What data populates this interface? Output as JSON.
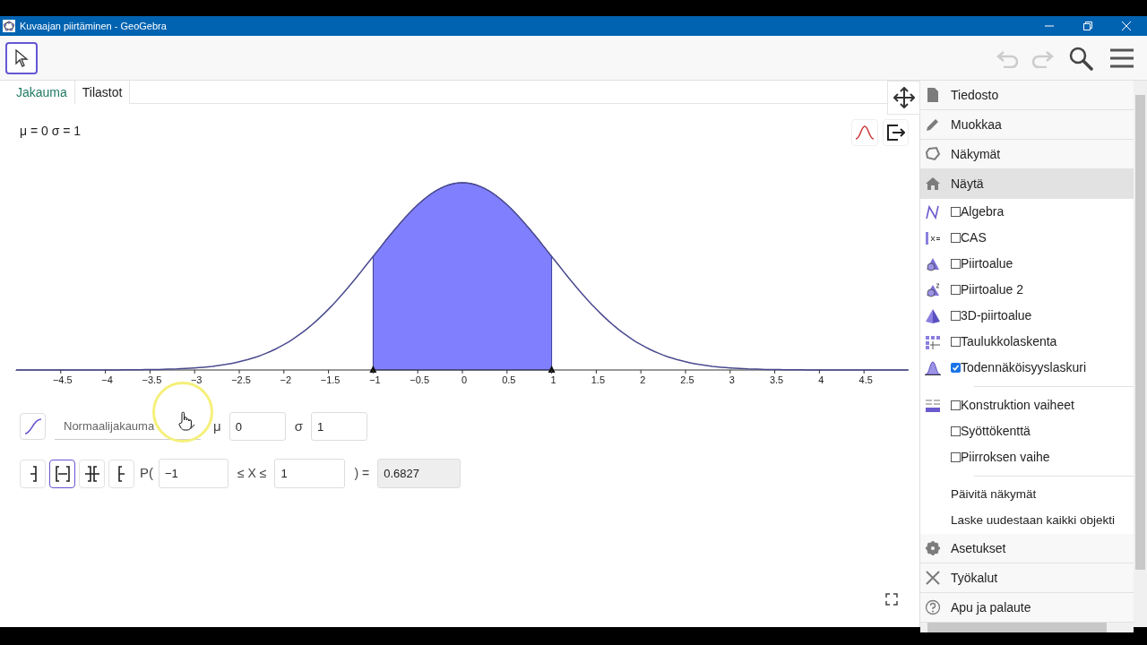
{
  "window": {
    "title": "Kuvaajan piirtäminen - GeoGebra"
  },
  "tabs": [
    {
      "label": "Jakauma",
      "selected": true
    },
    {
      "label": "Tilastot",
      "selected": false
    }
  ],
  "graph": {
    "parameters": "μ = 0 σ = 1",
    "axis_labels": [
      "−4.5",
      "−4",
      "−3.5",
      "−3",
      "−2.5",
      "−2",
      "−1.5",
      "−1",
      "−0.5",
      "0",
      "0.5",
      "1",
      "1.5",
      "2",
      "2.5",
      "3",
      "3.5",
      "4",
      "4.5"
    ]
  },
  "distribution": {
    "name": "Normaalijakauma",
    "mu_label": "μ",
    "mu": "0",
    "sigma_label": "σ",
    "sigma": "1"
  },
  "interval": {
    "modes": [
      {
        "selected": false
      },
      {
        "selected": true
      },
      {
        "selected": false
      },
      {
        "selected": false
      }
    ],
    "p_label": "P(",
    "low": "−1",
    "middle": "≤ X ≤",
    "high": "1",
    "equals": ") =",
    "result": "0.6827"
  },
  "menu": {
    "items": [
      {
        "kind": "header",
        "label": "Tiedosto",
        "selected": false
      },
      {
        "kind": "header",
        "label": "Muokkaa",
        "selected": false
      },
      {
        "kind": "header",
        "label": "Näkymät",
        "selected": false
      },
      {
        "kind": "header",
        "label": "Näytä",
        "selected": true
      },
      {
        "kind": "check",
        "label": "Algebra",
        "checked": false
      },
      {
        "kind": "check",
        "label": "CAS",
        "checked": false
      },
      {
        "kind": "check",
        "label": "Piirtoalue",
        "checked": false
      },
      {
        "kind": "check",
        "label": "Piirtoalue 2",
        "checked": false
      },
      {
        "kind": "check",
        "label": "3D-piirtoalue",
        "checked": false
      },
      {
        "kind": "check",
        "label": "Taulukkolaskenta",
        "checked": false
      },
      {
        "kind": "check",
        "label": "Todennäköisyyslaskuri",
        "checked": true
      },
      {
        "kind": "divider"
      },
      {
        "kind": "check",
        "label": "Konstruktion vaiheet",
        "checked": false
      },
      {
        "kind": "check",
        "label": "Syöttökenttä",
        "checked": false
      },
      {
        "kind": "check",
        "label": "Piirroksen vaihe",
        "checked": false
      },
      {
        "kind": "divider"
      },
      {
        "kind": "action",
        "label": "Päivitä näkymät"
      },
      {
        "kind": "action",
        "label": "Laske uudestaan kaikki objekti"
      },
      {
        "kind": "header",
        "label": "Asetukset",
        "selected": false
      },
      {
        "kind": "header",
        "label": "Työkalut",
        "selected": false
      },
      {
        "kind": "header",
        "label": "Apu ja palaute",
        "selected": false
      }
    ]
  }
}
